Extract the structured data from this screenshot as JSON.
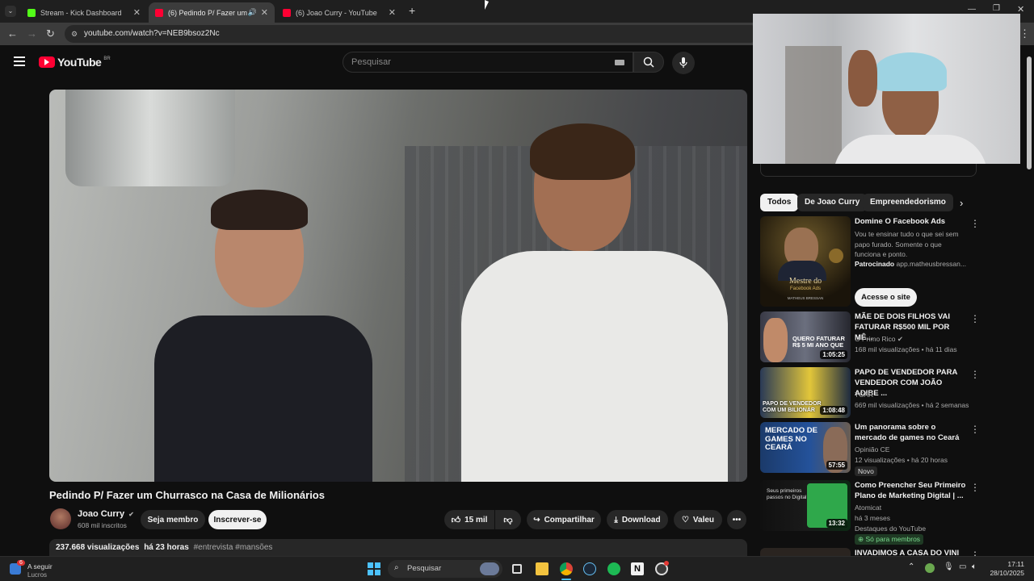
{
  "browser": {
    "tabs": [
      {
        "title": "Stream - Kick Dashboard",
        "favicon_color": "#53fc18"
      },
      {
        "title": "(6) Pedindo P/ Fazer um Ch",
        "favicon_color": "#ff0033"
      },
      {
        "title": "(6) Joao Curry - YouTube",
        "favicon_color": "#ff0033"
      }
    ],
    "url": "youtube.com/watch?v=NEB9bsoz2Nc"
  },
  "youtube": {
    "logo_text": "YouTube",
    "region": "BR",
    "search_placeholder": "Pesquisar",
    "accent": "#ff0033"
  },
  "video": {
    "title": "Pedindo P/ Fazer um Churrasco na Casa de Milionários",
    "channel": "Joao Curry",
    "subscribers": "608 mil inscritos",
    "member_label": "Seja membro",
    "subscribe_label": "Inscrever-se",
    "likes": "15 mil",
    "share_label": "Compartilhar",
    "download_label": "Download",
    "thanks_label": "Valeu",
    "views": "237.668 visualizações",
    "age": "há 23 horas",
    "hashtags": "#entrevista #mansões"
  },
  "sidebar": {
    "chips": [
      "Todos",
      "De Joao Curry",
      "Empreendedorismo"
    ],
    "ad": {
      "title": "Domine O Facebook Ads",
      "body": "Vou te ensinar tudo o que sei sem papo furado. Somente o que funciona e ponto.",
      "sponsored": "Patrocinado",
      "domain": "app.matheusbressan...",
      "cta": "Acesse o site",
      "thumb_text_1": "Mestre do",
      "thumb_text_2": "Facebook Ads",
      "thumb_text_3": "MATHEUS BRESSAN"
    },
    "recs": [
      {
        "title": "MÃE DE DOIS FILHOS VAI FATURAR R$500 MIL POR MÊ...",
        "channel": "O Primo Rico",
        "meta": "168 mil visualizações • há 11 dias",
        "duration": "1:05:25",
        "thumb_text": "QUERO FATURAR R$ 5 MI ANO QUE"
      },
      {
        "title": "PAPO DE VENDEDOR PARA VENDEDOR COM JOÃO ADIBE ...",
        "channel": "TCAR",
        "meta": "669 mil visualizações • há 2 semanas",
        "duration": "1:08:48",
        "thumb_text": "PAPO DE VENDEDOR COM UM BILIONÁR"
      },
      {
        "title": "Um panorama sobre o mercado de games no Ceará",
        "channel": "Opinião CE",
        "meta": "12 visualizações • há 20 horas",
        "badge": "Novo",
        "duration": "57:55",
        "thumb_text": "MERCADO DE GAMES NO CEARÁ"
      },
      {
        "title": "Como Preencher Seu Primeiro Plano de Marketing Digital | ...",
        "channel": "Atomicat",
        "meta": "há 3 meses",
        "extra": "Destaques do YouTube",
        "badge": "Só para membros",
        "duration": "13:32",
        "thumb_text": "Seus primeiros passos no Digital"
      },
      {
        "title": "INVADIMOS A CASA DO VINI",
        "channel": "",
        "meta": "",
        "duration": ""
      }
    ]
  },
  "taskbar": {
    "weather_badge": "6",
    "weather_line1": "A seguir",
    "weather_line2": "Lucros",
    "search_placeholder": "Pesquisar",
    "time": "17:11",
    "date": "28/10/2025"
  }
}
